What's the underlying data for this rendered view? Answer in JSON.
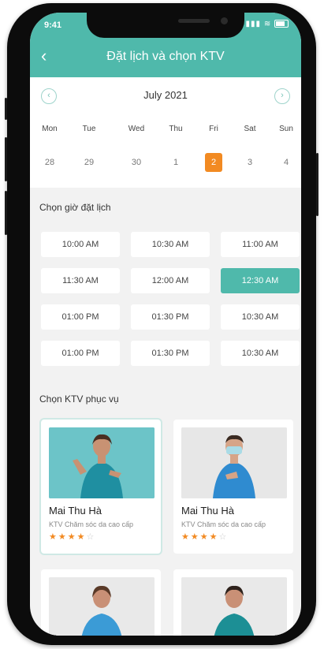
{
  "status_bar": {
    "time": "9:41",
    "signal": "▮▮▮ ≋"
  },
  "header": {
    "back_icon": "‹",
    "title": "Đặt lịch và chọn KTV"
  },
  "calendar": {
    "month": "July 2021",
    "prev_icon": "‹",
    "next_icon": "›",
    "weekdays": [
      "Mon",
      "Tue",
      "Wed",
      "Thu",
      "Fri",
      "Sat",
      "Sun"
    ],
    "dates": [
      "28",
      "29",
      "30",
      "1",
      "2",
      "3",
      "4"
    ],
    "selected_index": 4
  },
  "time_section": {
    "label": "Chọn giờ đặt lịch",
    "slots": [
      "10:00 AM",
      "10:30 AM",
      "11:00 AM",
      "11:30 AM",
      "12:00 AM",
      "12:30 AM",
      "01:00 PM",
      "01:30 PM",
      "10:30 AM",
      "01:00 PM",
      "01:30 PM",
      "10:30 AM"
    ],
    "active_index": 5
  },
  "ktv_section": {
    "label": "Chọn KTV phục vụ",
    "cards": [
      {
        "name": "Mai Thu Hà",
        "desc": "KTV Chăm sóc da cao cấp",
        "rating": 4
      },
      {
        "name": "Mai Thu Hà",
        "desc": "KTV Chăm sóc da cao cấp",
        "rating": 4
      }
    ]
  },
  "colors": {
    "accent": "#4fb9ab",
    "selected_date": "#f28a22"
  }
}
